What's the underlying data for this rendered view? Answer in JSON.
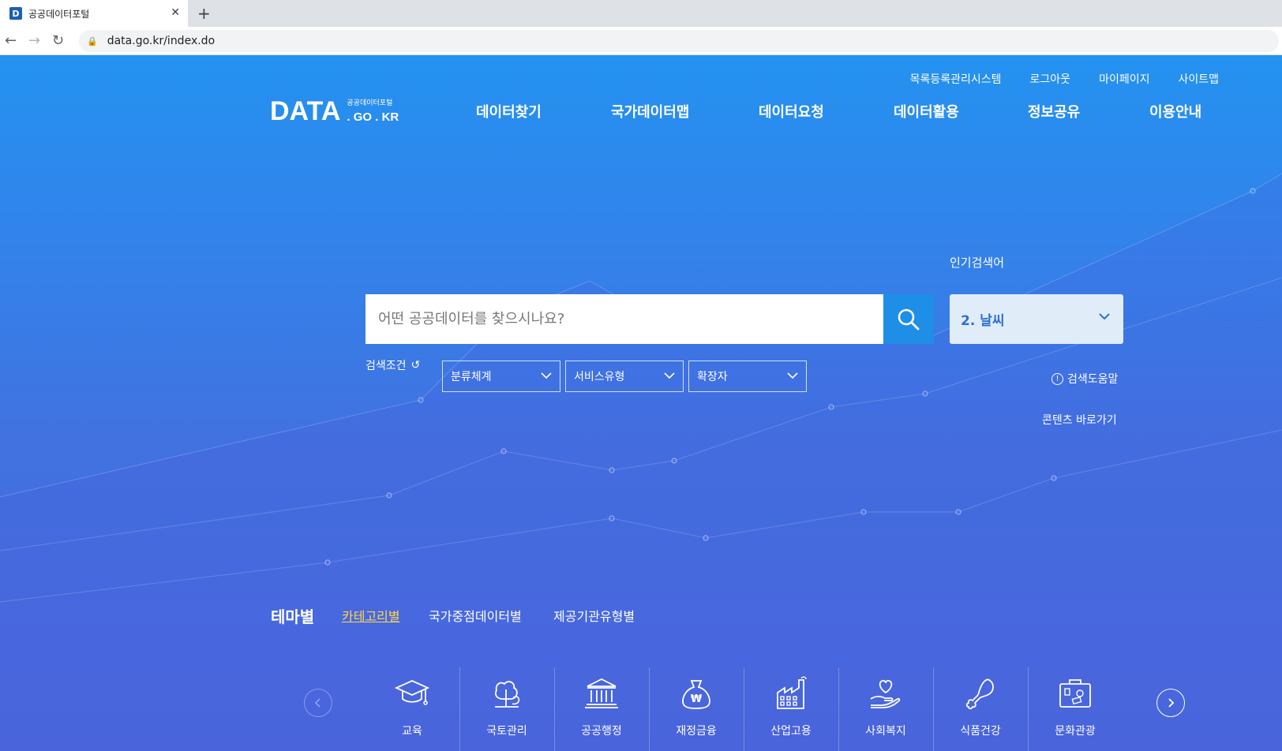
{
  "browser": {
    "tab_title": "공공데이터포털",
    "favicon_letter": "D",
    "url": "data.go.kr/index.do"
  },
  "utility_links": [
    "목록등록관리시스템",
    "로그아웃",
    "마이페이지",
    "사이트맵"
  ],
  "logo": {
    "main": "DATA",
    "sub_korean": "공공데이터포털",
    "sub_domain": ". GO . KR"
  },
  "gnb": [
    "데이터찾기",
    "국가데이터맵",
    "데이터요청",
    "데이터활용",
    "정보공유",
    "이용안내"
  ],
  "search": {
    "placeholder": "어떤 공공데이터를 찾으시나요?"
  },
  "popular": {
    "label": "인기검색어",
    "current": "2. 날씨"
  },
  "conditions": {
    "label": "검색조건",
    "selects": [
      "분류체계",
      "서비스유형",
      "확장자"
    ]
  },
  "help": {
    "search_help": "검색도움말",
    "shortcut": "콘텐츠 바로가기"
  },
  "theme_tabs": {
    "heading": "테마별",
    "tabs": [
      "카테고리별",
      "국가중점데이터별",
      "제공기관유형별"
    ],
    "active_index": 0
  },
  "categories": [
    "교육",
    "국토관리",
    "공공행정",
    "재정금융",
    "산업고용",
    "사회복지",
    "식품건강",
    "문화관광"
  ],
  "colors": {
    "hero_top": "#2492f0",
    "hero_bottom": "#4a67dc",
    "search_button": "#1e8ee6",
    "active_tab": "#ffd64a"
  }
}
